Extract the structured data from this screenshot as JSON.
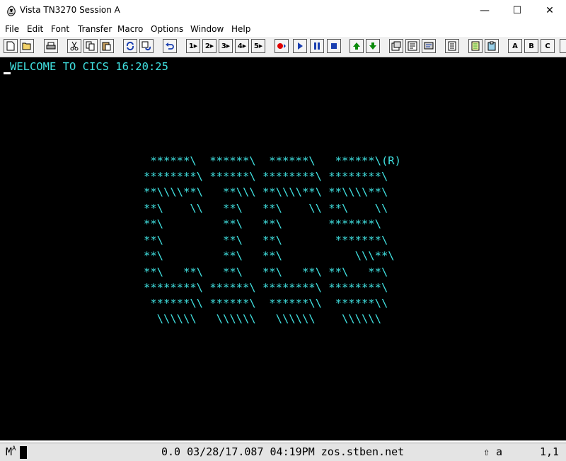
{
  "window": {
    "title": "Vista TN3270 Session A",
    "minimize": "—",
    "maximize": "☐",
    "close": "✕"
  },
  "menu": [
    "File",
    "Edit",
    "Font",
    "Transfer",
    "Macro",
    "Options",
    "Window",
    "Help"
  ],
  "toolbar": {
    "macro_buttons": [
      "1",
      "2",
      "3",
      "4",
      "5"
    ],
    "letter_buttons": [
      "A",
      "B",
      "C"
    ]
  },
  "terminal": {
    "welcome": "WELCOME TO CICS 16:20:25",
    "logo": [
      " ******\\  ******\\  ******\\   ******\\(R)",
      "********\\ ******\\ ********\\ ********\\",
      "**\\\\\\\\**\\   **\\\\\\ **\\\\\\\\**\\ **\\\\\\\\**\\",
      "**\\    \\\\   **\\   **\\    \\\\ **\\    \\\\",
      "**\\         **\\   **\\       *******\\",
      "**\\         **\\   **\\        *******\\",
      "**\\         **\\   **\\           \\\\\\**\\",
      "**\\   **\\   **\\   **\\   **\\ **\\   **\\",
      "********\\ ******\\ ********\\ ********\\",
      " ******\\\\ ******\\  ******\\\\  ******\\\\",
      "  \\\\\\\\\\\\   \\\\\\\\\\\\   \\\\\\\\\\\\    \\\\\\\\\\\\"
    ],
    "colors": {
      "background": "#000000",
      "text": "#40e0e0"
    }
  },
  "status": {
    "mode": "M",
    "mode_sub": "A",
    "info": "0.0 03/28/17.087 04:19PM zos.stben.net",
    "shift_indicator": "⇧ a",
    "cursor_position": "1,1"
  }
}
